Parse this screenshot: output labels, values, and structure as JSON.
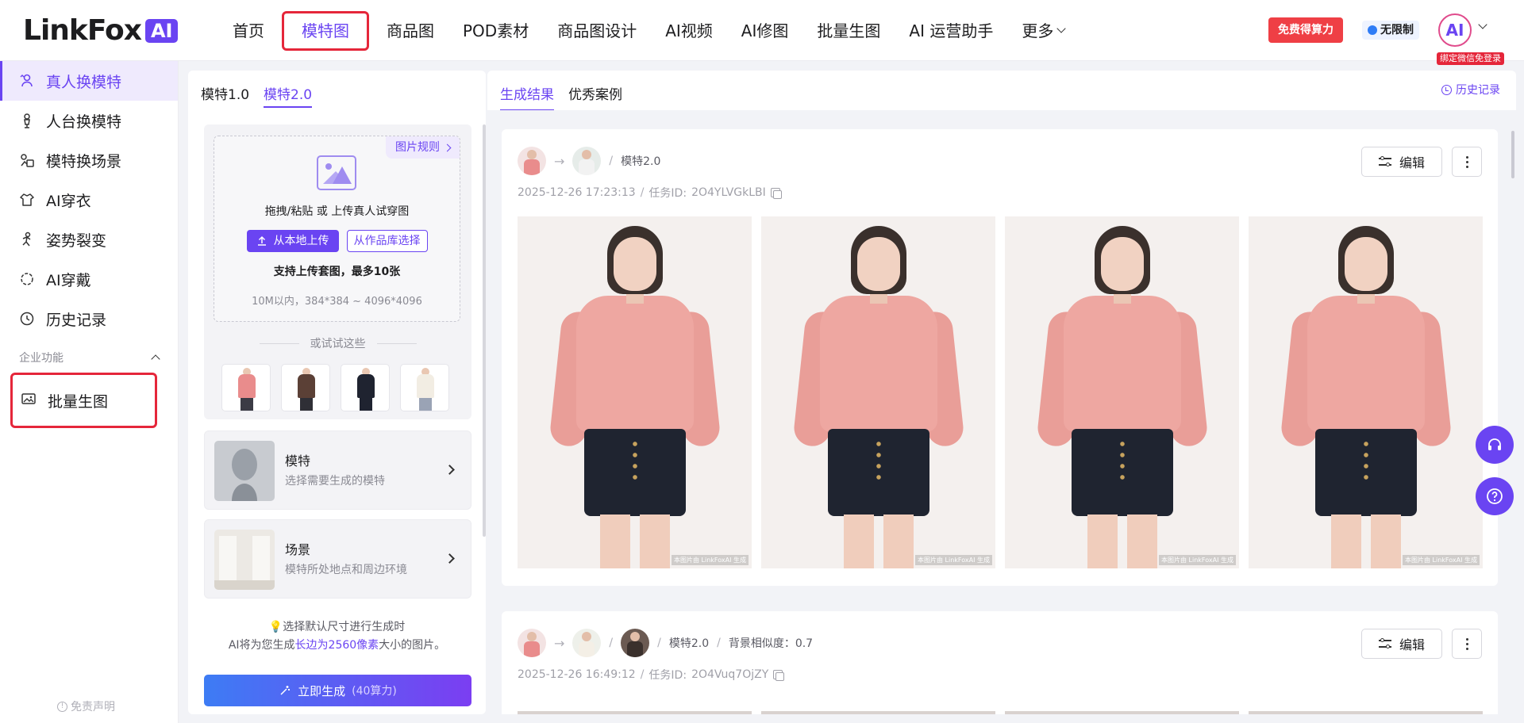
{
  "brand": {
    "logo_text": "LinkFox",
    "logo_badge": "AI"
  },
  "nav": {
    "items": [
      "首页",
      "模特图",
      "商品图",
      "POD素材",
      "商品图设计",
      "AI视频",
      "AI修图",
      "批量生图",
      "AI 运营助手"
    ],
    "more": "更多",
    "active": "模特图"
  },
  "header": {
    "free_compute": "免费得算力",
    "unlimited": "无限制",
    "avatar_text": "AI",
    "bind_tip": "绑定微信免登录"
  },
  "sidebar": {
    "items": [
      {
        "label": "真人换模特",
        "icon": "person-swap-icon",
        "active": true
      },
      {
        "label": "人台换模特",
        "icon": "mannequin-icon"
      },
      {
        "label": "模特换场景",
        "icon": "scene-icon"
      },
      {
        "label": "AI穿衣",
        "icon": "shirt-icon"
      },
      {
        "label": "姿势裂变",
        "icon": "pose-icon"
      },
      {
        "label": "AI穿戴",
        "icon": "accessory-icon"
      },
      {
        "label": "历史记录",
        "icon": "history-icon"
      }
    ],
    "section": "企业功能",
    "enterprise_item": "批量生图",
    "disclaimer": "免责声明"
  },
  "config": {
    "tabs": [
      "模特1.0",
      "模特2.0"
    ],
    "active_tab": "模特2.0",
    "upload": {
      "rules": "图片规则",
      "title": "拖拽/粘贴 或 上传真人试穿图",
      "upload_local": "从本地上传",
      "from_library": "从作品库选择",
      "note": "支持上传套图，最多10张",
      "size": "10M以内，384*384 ~ 4096*4096"
    },
    "try_these": "或试试这些",
    "model_card": {
      "title": "模特",
      "subtitle": "选择需要生成的模特"
    },
    "scene_card": {
      "title": "场景",
      "subtitle": "模特所处地点和周边环境"
    },
    "tip_line1": "💡选择默认尺寸进行生成时",
    "tip_line2_pre": "AI将为您生成",
    "tip_line2_hl": "长边为2560像素",
    "tip_line2_post": "大小的图片。",
    "generate": "立即生成",
    "cost": "(40算力)"
  },
  "results": {
    "tabs": [
      "生成结果",
      "优秀案例"
    ],
    "active_tab": "生成结果",
    "history": "历史记录",
    "edit": "编辑",
    "items": [
      {
        "model": "模特2.0",
        "time": "2025-12-26 17:23:13",
        "task_label": "任务ID:",
        "task_id": "2O4YLVGkLBI",
        "watermark": "本图片由 LinkFoxAI 生成"
      },
      {
        "model": "模特2.0",
        "extra": "背景相似度：0.7",
        "time": "2025-12-26 16:49:12",
        "task_label": "任务ID:",
        "task_id": "2O4Vuq7OjZY"
      }
    ]
  },
  "colors": {
    "accent": "#6a44f2",
    "highlight": "#e5263a",
    "free_btn": "#ef3f45"
  },
  "float_buttons": [
    "headset-icon",
    "help-icon"
  ]
}
